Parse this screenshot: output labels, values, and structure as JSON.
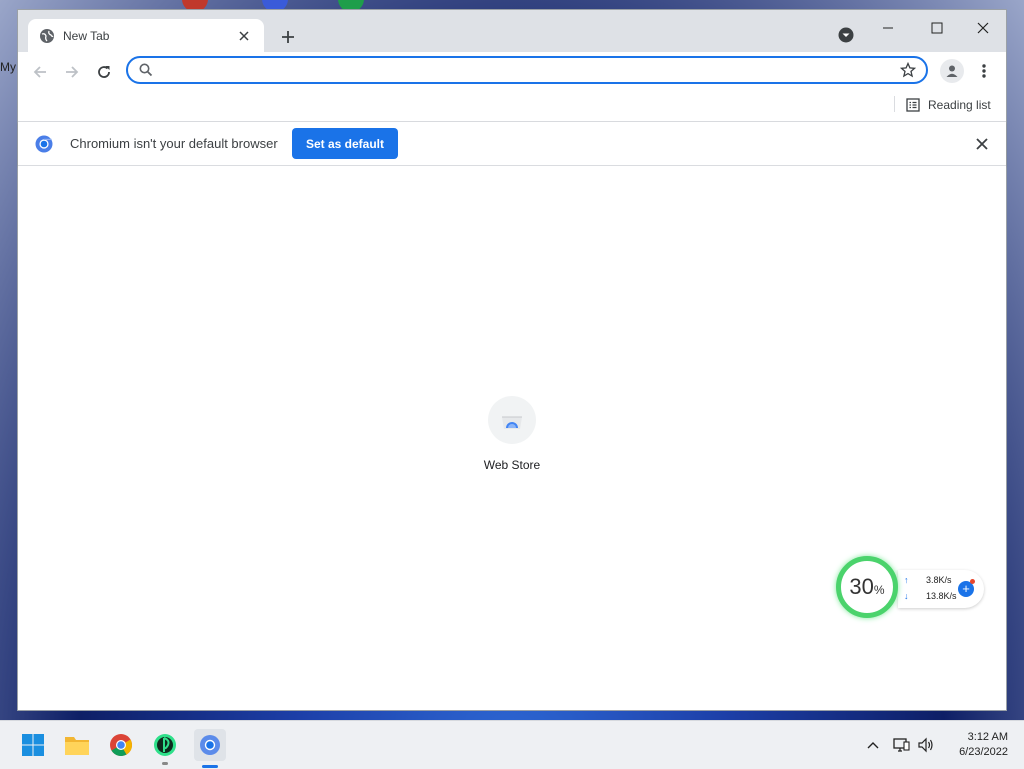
{
  "desktop": {
    "label": "My"
  },
  "browser": {
    "tab": {
      "title": "New Tab"
    },
    "omnibox": {
      "value": "",
      "placeholder": ""
    },
    "bookmarks": {
      "reading_list": "Reading list"
    },
    "infobar": {
      "message": "Chromium isn't your default browser",
      "button": "Set as default"
    },
    "shortcuts": [
      {
        "label": "Web Store",
        "icon": "web-store-icon"
      }
    ]
  },
  "widget": {
    "percent": "30",
    "percent_sign": "%",
    "upload": "3.8K/s",
    "download": "13.8K/s",
    "ring_color": "#4bd36c"
  },
  "taskbar": {
    "apps": [
      "start-icon",
      "file-explorer-icon",
      "chrome-icon",
      "terminal-app-icon",
      "chromium-icon"
    ],
    "clock": {
      "time": "3:12 AM",
      "date": "6/23/2022"
    }
  },
  "colors": {
    "accent": "#1a73e8",
    "tabstrip": "#dee1e6"
  }
}
